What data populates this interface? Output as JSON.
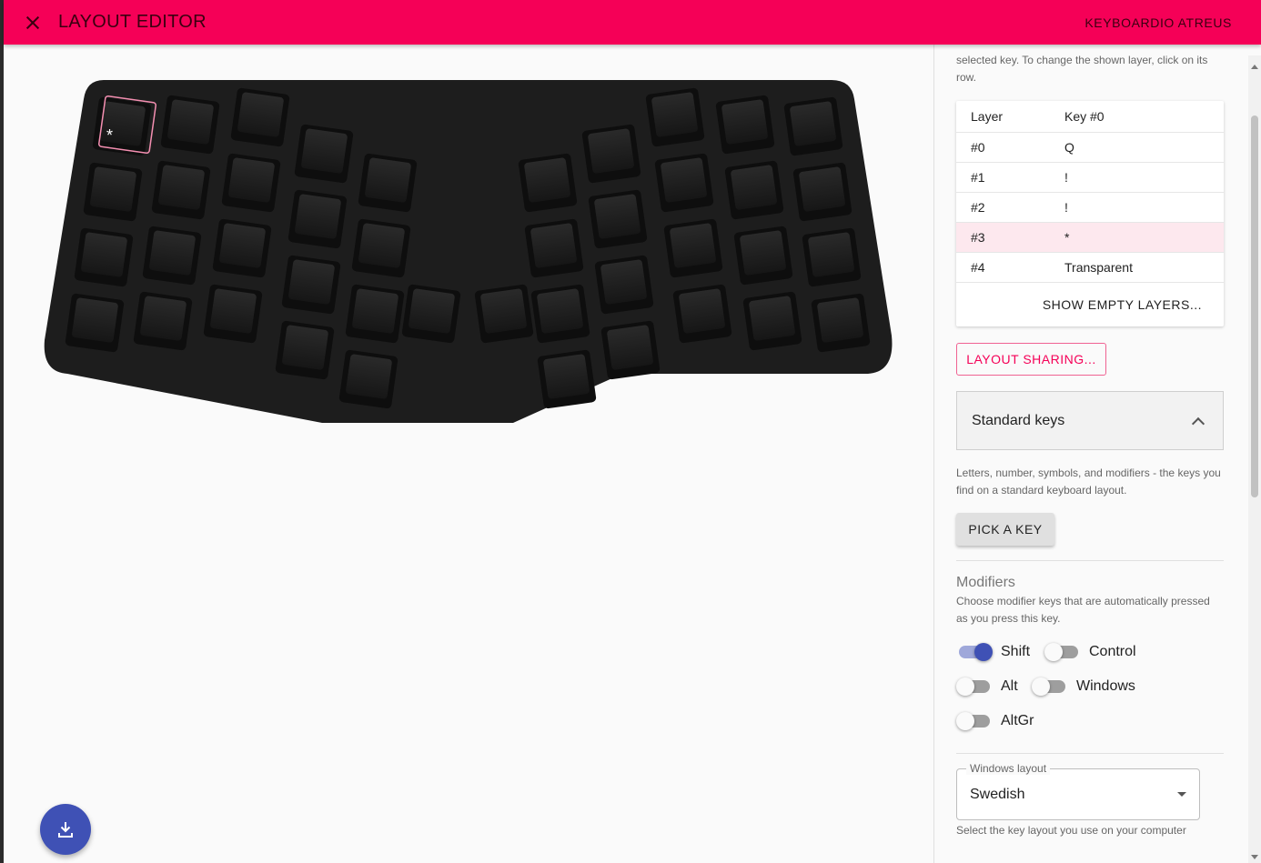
{
  "appbar": {
    "title": "LAYOUT EDITOR",
    "device": "KEYBOARDIO ATREUS"
  },
  "keyboard": {
    "selected_key_label": "*"
  },
  "sidebar": {
    "intro": "selected key. To change the shown layer, click on its row.",
    "layer_table": {
      "headers": [
        "Layer",
        "Key #0"
      ],
      "rows": [
        {
          "layer": "#0",
          "key": "Q"
        },
        {
          "layer": "#1",
          "key": "!"
        },
        {
          "layer": "#2",
          "key": "!"
        },
        {
          "layer": "#3",
          "key": "*"
        },
        {
          "layer": "#4",
          "key": "Transparent"
        }
      ],
      "show_empty_label": "SHOW EMPTY LAYERS..."
    },
    "layout_sharing_label": "LAYOUT SHARING...",
    "standard_keys": {
      "title": "Standard keys",
      "description": "Letters, number, symbols, and modifiers - the keys you find on a standard keyboard layout.",
      "pick_label": "PICK A KEY"
    },
    "modifiers": {
      "title": "Modifiers",
      "description": "Choose modifier keys that are automatically pressed as you press this key.",
      "items": [
        {
          "label": "Shift",
          "on": true
        },
        {
          "label": "Control",
          "on": false
        },
        {
          "label": "Alt",
          "on": false
        },
        {
          "label": "Windows",
          "on": false
        },
        {
          "label": "AltGr",
          "on": false
        }
      ]
    },
    "windows_layout": {
      "legend": "Windows layout",
      "value": "Swedish",
      "help": "Select the key layout you use on your computer"
    }
  },
  "colors": {
    "appbar": "#f50057",
    "accent": "#3f51b5",
    "selected_row": "#fde8ee"
  }
}
